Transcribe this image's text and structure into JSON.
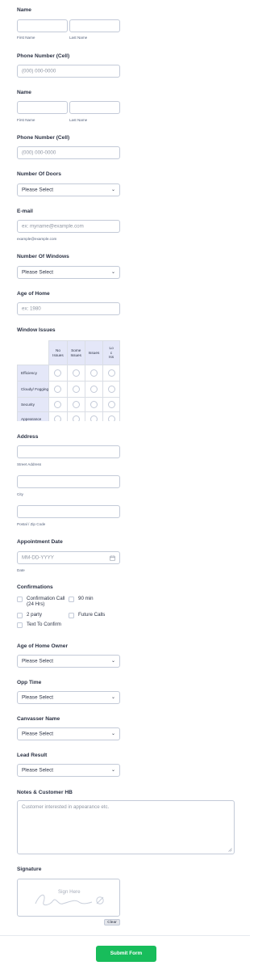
{
  "name1": {
    "label": "Name",
    "first_sub": "First Name",
    "last_sub": "Last Name"
  },
  "phone1": {
    "label": "Phone Number (Cell)",
    "placeholder": "(000) 000-0000"
  },
  "name2": {
    "label": "Name",
    "first_sub": "First Name",
    "last_sub": "Last Name"
  },
  "phone2": {
    "label": "Phone Number (Cell)",
    "placeholder": "(000) 000-0000"
  },
  "doors": {
    "label": "Number Of Doors",
    "value": "Please Select"
  },
  "email": {
    "label": "E-mail",
    "placeholder": "ex: myname@example.com",
    "sub": "example@example.com"
  },
  "windows": {
    "label": "Number Of Windows",
    "value": "Please Select"
  },
  "age_home": {
    "label": "Age of Home",
    "placeholder": "ex: 1980"
  },
  "window_issues": {
    "label": "Window Issues",
    "columns": [
      "No Issues",
      "Some Issues",
      "Issues",
      "Lo\nc\nIss"
    ],
    "rows": [
      "Efficiency",
      "Cloudy/ Fogging",
      "Security",
      "Appearance"
    ]
  },
  "address": {
    "label": "Address",
    "street_sub": "Street Address",
    "city_sub": "City",
    "zip_sub": "Postal / Zip Code"
  },
  "appointment": {
    "label": "Appointment Date",
    "placeholder": "MM-DD-YYYY",
    "sub": "Date",
    "icon": "calendar-icon"
  },
  "confirmations": {
    "label": "Confirmations",
    "options": [
      "Confirmation Call (24 Hrs)",
      "90 min",
      "2 party",
      "Future Calls",
      "Text To Confirm"
    ]
  },
  "age_owner": {
    "label": "Age of Home Owner",
    "value": "Please Select"
  },
  "opp_time": {
    "label": "Opp Time",
    "value": "Please Select"
  },
  "canvasser": {
    "label": "Canvasser Name",
    "value": "Please Select"
  },
  "lead_result": {
    "label": "Lead Result",
    "value": "Please Select"
  },
  "notes": {
    "label": "Notes & Customer HB",
    "placeholder": "Customer interested in appearance etc."
  },
  "signature": {
    "label": "Signature",
    "hint": "Sign Here",
    "clear": "Clear"
  },
  "submit": {
    "label": "Submit Form"
  },
  "colors": {
    "accent": "#18bd5b",
    "matrix_header": "#e4e7f8",
    "border": "#c3cad8",
    "text": "#2c3345"
  }
}
